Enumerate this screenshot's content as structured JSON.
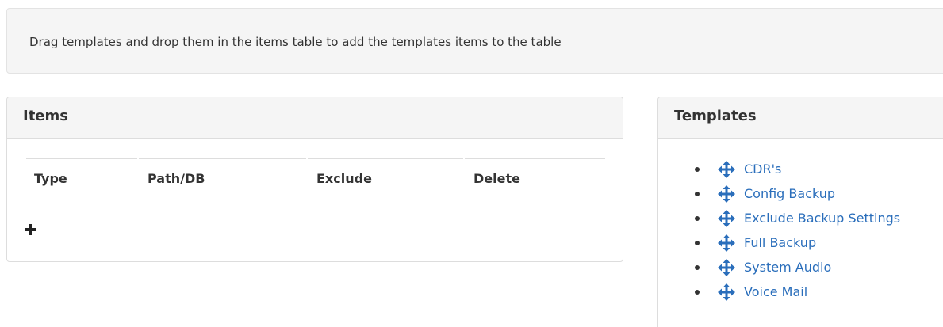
{
  "info": {
    "text": "Drag templates and drop them in the items table to add the templates items to the table"
  },
  "items_panel": {
    "title": "Items",
    "columns": [
      "Type",
      "Path/DB",
      "Exclude",
      "Delete"
    ],
    "add_icon": "plus-icon"
  },
  "templates_panel": {
    "title": "Templates",
    "drag_icon": "move-arrows-icon",
    "link_color": "#2a6ebb",
    "items": [
      {
        "label": "CDR's"
      },
      {
        "label": "Config Backup"
      },
      {
        "label": "Exclude Backup Settings"
      },
      {
        "label": "Full Backup"
      },
      {
        "label": "System Audio"
      },
      {
        "label": "Voice Mail"
      }
    ]
  }
}
